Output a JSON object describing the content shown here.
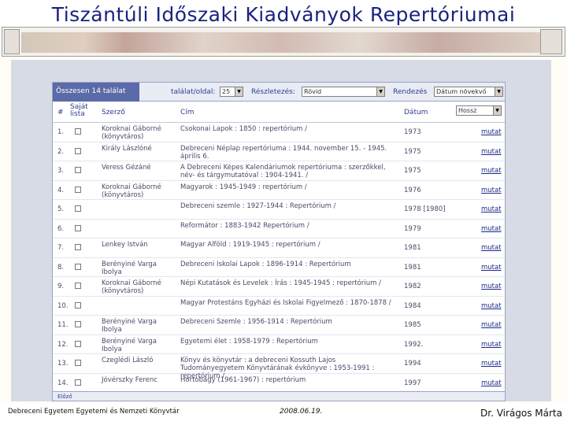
{
  "slide": {
    "title": "Tiszántúli Időszaki Kiadványok Repertóriumai",
    "footer_left": "Debreceni Egyetem Egyetemi és Nemzeti Könyvtár",
    "footer_date": "2008.06.19.",
    "footer_right": "Dr. Virágos Márta"
  },
  "toolbar": {
    "total": "Összesen 14 találat",
    "per_page_label": "találat/oldal:",
    "per_page_value": "25",
    "detail_label": "Részletezés:",
    "detail_value": "Rövid",
    "sort_label": "Rendezés",
    "sort_value": "Dátum növekvő"
  },
  "table": {
    "headers": {
      "num": "#",
      "own_list": "Saját lista",
      "author": "Szerző",
      "title": "Cím",
      "date": "Dátum",
      "filter": "Hossz"
    },
    "more_label": "mutat",
    "rows": [
      {
        "num": "1.",
        "author": "Koroknai Gáborné (könyvtáros)",
        "title": "Csokonai Lapok : 1850 : repertórium /",
        "date": "1973"
      },
      {
        "num": "2.",
        "author": "Király Lászlóné",
        "title": "Debreceni Néplap repertóriuma : 1944. november 15. - 1945. április 6.",
        "date": "1975"
      },
      {
        "num": "3.",
        "author": "Veress Gézáné",
        "title": "A Debreceni Képes Kalendáriumok repertóriuma : szerzőkkel, név- és tárgymutatóval : 1904-1941. /",
        "date": "1975"
      },
      {
        "num": "4.",
        "author": "Koroknai Gáborné (könyvtáros)",
        "title": "Magyarok : 1945-1949 : repertórium /",
        "date": "1976"
      },
      {
        "num": "5.",
        "author": "",
        "title": "Debreceni szemle : 1927-1944 : Repertórium /",
        "date": "1978 [1980]"
      },
      {
        "num": "6.",
        "author": "",
        "title": "Reformátor : 1883-1942 Repertórium /",
        "date": "1979"
      },
      {
        "num": "7.",
        "author": "Lenkey István",
        "title": "Magyar Alföld : 1919-1945 : repertórium /",
        "date": "1981"
      },
      {
        "num": "8.",
        "author": "Berényiné Varga Ibolya",
        "title": "Debreceni Iskolai Lapok : 1896-1914 : Repertórium",
        "date": "1981"
      },
      {
        "num": "9.",
        "author": "Koroknai Gáborné (könyvtáros)",
        "title": "Népi Kutatások és Levelek : Írás : 1945-1945 : repertórium /",
        "date": "1982"
      },
      {
        "num": "10.",
        "author": "",
        "title": "Magyar Protestáns Egyházi és Iskolai Figyelmező : 1870-1878 /",
        "date": "1984"
      },
      {
        "num": "11.",
        "author": "Berényiné Varga Ibolya",
        "title": "Debreceni Szemle : 1956-1914 : Repertórium",
        "date": "1985"
      },
      {
        "num": "12.",
        "author": "Berényiné Varga Ibolya",
        "title": "Egyetemi élet : 1958-1979 : Repertórium",
        "date": "1992."
      },
      {
        "num": "13.",
        "author": "Czeglédi László",
        "title": "Könyv és könyvtár : a debreceni Kossuth Lajos Tudományegyetem Könyvtárának évkönyve : 1953-1991 : repertórium /",
        "date": "1994"
      },
      {
        "num": "14.",
        "author": "Jóvérszky Ferenc",
        "title": "Hortobágy (1961-1967) : repertórium",
        "date": "1997"
      }
    ]
  },
  "bottom": {
    "label": "Előző"
  }
}
